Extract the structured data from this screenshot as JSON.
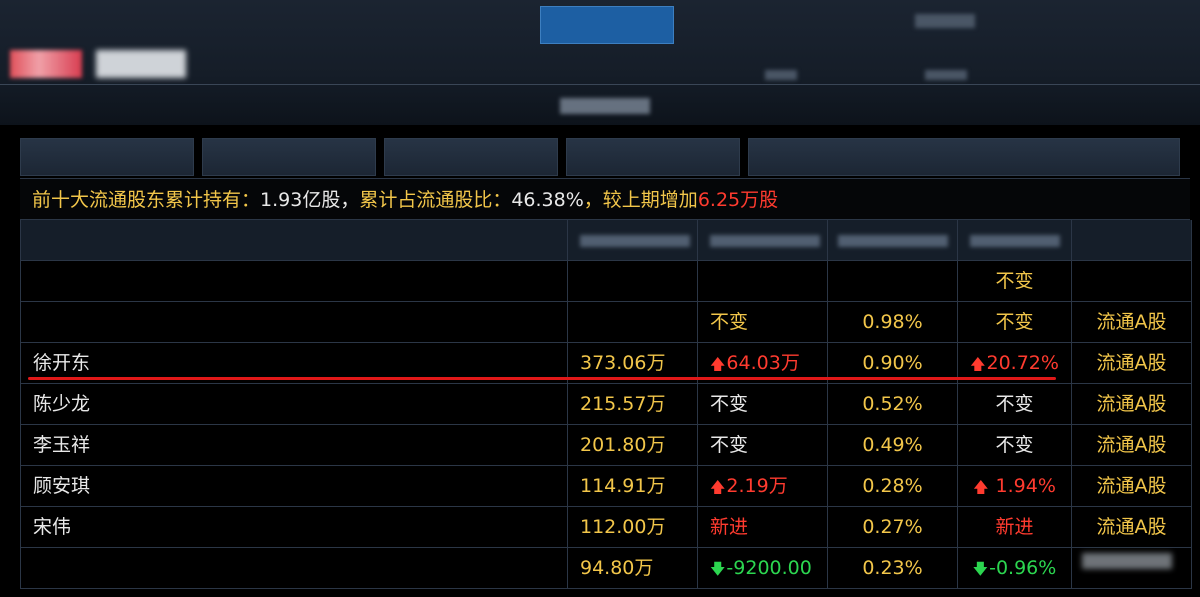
{
  "summary": {
    "label1": "前十大流通股东累计持有：",
    "val1": "1.93亿股，",
    "label2": "累计占流通股比：",
    "val2": "46.38%",
    "label3": "，较上期增加",
    "val3": "6.25万股"
  },
  "rows": [
    {
      "name": "",
      "amount": "",
      "change": "",
      "ratio": "",
      "ratio_change": "不变",
      "type": ""
    },
    {
      "name": "",
      "amount": "",
      "change": "不变",
      "ratio": "0.98%",
      "ratio_change": "不变",
      "type": "流通A股"
    },
    {
      "name": "徐开东",
      "amount": "373.06万",
      "change": "64.03万",
      "ratio": "0.90%",
      "ratio_change": "20.72%",
      "type": "流通A股"
    },
    {
      "name": "陈少龙",
      "amount": "215.57万",
      "change": "不变",
      "ratio": "0.52%",
      "ratio_change": "不变",
      "type": "流通A股"
    },
    {
      "name": "李玉祥",
      "amount": "201.80万",
      "change": "不变",
      "ratio": "0.49%",
      "ratio_change": "不变",
      "type": "流通A股"
    },
    {
      "name": "顾安琪",
      "amount": "114.91万",
      "change": "2.19万",
      "ratio": "0.28%",
      "ratio_change": " 1.94%",
      "type": "流通A股"
    },
    {
      "name": "宋伟",
      "amount": "112.00万",
      "change": "新进",
      "ratio": "0.27%",
      "ratio_change": "新进",
      "type": "流通A股"
    },
    {
      "name": "",
      "amount": "94.80万",
      "change": "-9200.00",
      "ratio": "0.23%",
      "ratio_change": "-0.96%",
      "type": ""
    }
  ],
  "icons": {
    "up": "arrow-up-icon",
    "down": "arrow-down-icon"
  },
  "colors": {
    "gold": "#f2c64a",
    "red": "#ff3b2f",
    "green": "#2cd650",
    "highlight": "#e01818"
  }
}
